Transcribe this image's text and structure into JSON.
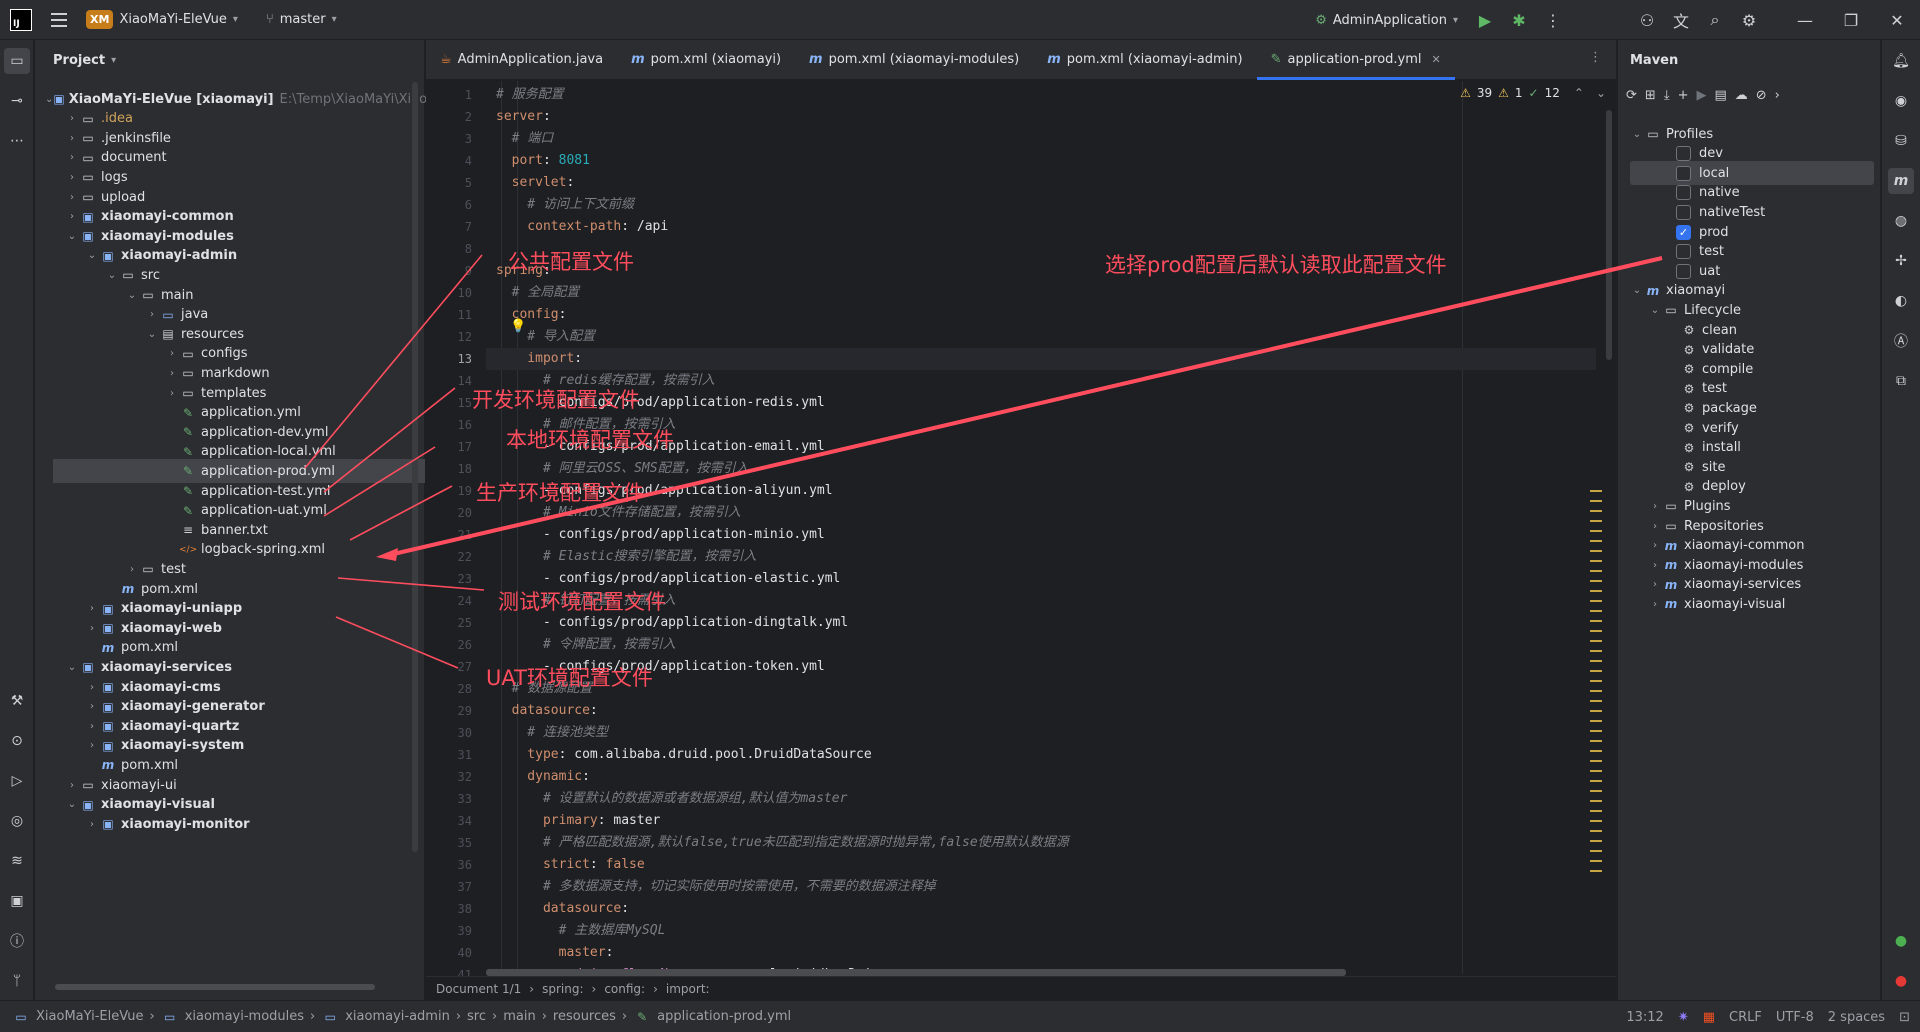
{
  "titlebar": {
    "project_badge": "XM",
    "project_name": "XiaoMaYi-EleVue",
    "branch": "master",
    "run_config": "AdminApplication"
  },
  "project_panel": {
    "title": "Project",
    "tree": [
      {
        "label": "XiaoMaYi-EleVue [xiaomayi]",
        "extra": "E:\\Temp\\XiaoMaYi\\XiaoMa",
        "depth": 0,
        "expanded": true,
        "icon": "module-folder-icon",
        "bold": true
      },
      {
        "label": ".idea",
        "depth": 1,
        "expanded": false,
        "icon": "folder-icon"
      },
      {
        "label": ".jenkinsfile",
        "depth": 1,
        "expanded": false,
        "icon": "folder-icon"
      },
      {
        "label": "document",
        "depth": 1,
        "expanded": false,
        "icon": "folder-icon"
      },
      {
        "label": "logs",
        "depth": 1,
        "expanded": false,
        "icon": "folder-icon"
      },
      {
        "label": "upload",
        "depth": 1,
        "expanded": false,
        "icon": "folder-icon"
      },
      {
        "label": "xiaomayi-common",
        "depth": 1,
        "expanded": false,
        "icon": "module-folder-icon",
        "bold": true
      },
      {
        "label": "xiaomayi-modules",
        "depth": 1,
        "expanded": true,
        "icon": "module-folder-icon",
        "bold": true
      },
      {
        "label": "xiaomayi-admin",
        "depth": 2,
        "expanded": true,
        "icon": "module-folder-icon",
        "bold": true
      },
      {
        "label": "src",
        "depth": 3,
        "expanded": true,
        "icon": "folder-icon"
      },
      {
        "label": "main",
        "depth": 4,
        "expanded": true,
        "icon": "folder-icon"
      },
      {
        "label": "java",
        "depth": 5,
        "expanded": false,
        "icon": "source-folder-icon"
      },
      {
        "label": "resources",
        "depth": 5,
        "expanded": true,
        "icon": "resources-folder-icon"
      },
      {
        "label": "configs",
        "depth": 6,
        "expanded": false,
        "icon": "folder-icon"
      },
      {
        "label": "markdown",
        "depth": 6,
        "expanded": false,
        "icon": "folder-icon"
      },
      {
        "label": "templates",
        "depth": 6,
        "expanded": false,
        "icon": "folder-icon"
      },
      {
        "label": "application.yml",
        "depth": 6,
        "icon": "yaml-file-icon"
      },
      {
        "label": "application-dev.yml",
        "depth": 6,
        "icon": "yaml-file-icon"
      },
      {
        "label": "application-local.yml",
        "depth": 6,
        "icon": "yaml-file-icon"
      },
      {
        "label": "application-prod.yml",
        "depth": 6,
        "icon": "yaml-file-icon",
        "selected": true
      },
      {
        "label": "application-test.yml",
        "depth": 6,
        "icon": "yaml-file-icon"
      },
      {
        "label": "application-uat.yml",
        "depth": 6,
        "icon": "yaml-file-icon"
      },
      {
        "label": "banner.txt",
        "depth": 6,
        "icon": "text-file-icon"
      },
      {
        "label": "logback-spring.xml",
        "depth": 6,
        "icon": "xml-file-icon"
      },
      {
        "label": "test",
        "depth": 4,
        "expanded": false,
        "icon": "folder-icon"
      },
      {
        "label": "pom.xml",
        "depth": 3,
        "icon": "maven-file-icon"
      },
      {
        "label": "xiaomayi-uniapp",
        "depth": 2,
        "expanded": false,
        "icon": "module-folder-icon",
        "bold": true
      },
      {
        "label": "xiaomayi-web",
        "depth": 2,
        "expanded": false,
        "icon": "module-folder-icon",
        "bold": true
      },
      {
        "label": "pom.xml",
        "depth": 2,
        "icon": "maven-file-icon"
      },
      {
        "label": "xiaomayi-services",
        "depth": 1,
        "expanded": true,
        "icon": "module-folder-icon",
        "bold": true
      },
      {
        "label": "xiaomayi-cms",
        "depth": 2,
        "expanded": false,
        "icon": "module-folder-icon",
        "bold": true
      },
      {
        "label": "xiaomayi-generator",
        "depth": 2,
        "expanded": false,
        "icon": "module-folder-icon",
        "bold": true
      },
      {
        "label": "xiaomayi-quartz",
        "depth": 2,
        "expanded": false,
        "icon": "module-folder-icon",
        "bold": true
      },
      {
        "label": "xiaomayi-system",
        "depth": 2,
        "expanded": false,
        "icon": "module-folder-icon",
        "bold": true
      },
      {
        "label": "pom.xml",
        "depth": 2,
        "icon": "maven-file-icon"
      },
      {
        "label": "xiaomayi-ui",
        "depth": 1,
        "expanded": false,
        "icon": "folder-icon"
      },
      {
        "label": "xiaomayi-visual",
        "depth": 1,
        "expanded": true,
        "icon": "module-folder-icon",
        "bold": true
      },
      {
        "label": "xiaomayi-monitor",
        "depth": 2,
        "expanded": false,
        "icon": "module-folder-icon",
        "bold": true
      }
    ]
  },
  "editor": {
    "tabs": [
      {
        "label": "AdminApplication.java",
        "icon": "java-class-icon"
      },
      {
        "label": "pom.xml (xiaomayi)",
        "icon": "maven-file-icon"
      },
      {
        "label": "pom.xml (xiaomayi-modules)",
        "icon": "maven-file-icon"
      },
      {
        "label": "pom.xml (xiaomayi-admin)",
        "icon": "maven-file-icon"
      },
      {
        "label": "application-prod.yml",
        "icon": "yaml-file-icon",
        "active": true,
        "closable": true
      }
    ],
    "inspections": {
      "warnings": "39",
      "weak_warnings": "1",
      "ok": "12"
    },
    "current_line": 13,
    "lines": [
      {
        "n": 1,
        "parts": [
          {
            "t": "# 服务配置",
            "c": "c"
          }
        ]
      },
      {
        "n": 2,
        "parts": [
          {
            "t": "server",
            "c": "k"
          },
          {
            "t": ":",
            "c": "v"
          }
        ]
      },
      {
        "n": 3,
        "parts": [
          {
            "t": "  # 端口",
            "c": "c"
          }
        ]
      },
      {
        "n": 4,
        "parts": [
          {
            "t": "  port",
            "c": "k"
          },
          {
            "t": ": ",
            "c": "v"
          },
          {
            "t": "8081",
            "c": "n"
          }
        ]
      },
      {
        "n": 5,
        "parts": [
          {
            "t": "  servlet",
            "c": "k"
          },
          {
            "t": ":",
            "c": "v"
          }
        ]
      },
      {
        "n": 6,
        "parts": [
          {
            "t": "    # 访问上下文前缀",
            "c": "c"
          }
        ]
      },
      {
        "n": 7,
        "parts": [
          {
            "t": "    context-path",
            "c": "k"
          },
          {
            "t": ": /api",
            "c": "v"
          }
        ]
      },
      {
        "n": 8,
        "parts": []
      },
      {
        "n": 9,
        "parts": [
          {
            "t": "spring",
            "c": "k"
          },
          {
            "t": ":",
            "c": "v"
          }
        ]
      },
      {
        "n": 10,
        "parts": [
          {
            "t": "  # 全局配置",
            "c": "c"
          }
        ]
      },
      {
        "n": 11,
        "parts": [
          {
            "t": "  config",
            "c": "k"
          },
          {
            "t": ":",
            "c": "v"
          }
        ]
      },
      {
        "n": 12,
        "parts": [
          {
            "t": "    # 导入配置",
            "c": "c"
          }
        ]
      },
      {
        "n": 13,
        "parts": [
          {
            "t": "    import",
            "c": "k"
          },
          {
            "t": ":",
            "c": "v"
          }
        ]
      },
      {
        "n": 14,
        "parts": [
          {
            "t": "      # redis缓存配置，按需引入",
            "c": "c"
          }
        ]
      },
      {
        "n": 15,
        "parts": [
          {
            "t": "      - configs/prod/application-redis.yml",
            "c": "v"
          }
        ]
      },
      {
        "n": 16,
        "parts": [
          {
            "t": "      # 邮件配置，按需引入",
            "c": "c"
          }
        ]
      },
      {
        "n": 17,
        "parts": [
          {
            "t": "      - configs/prod/application-email.yml",
            "c": "v"
          }
        ]
      },
      {
        "n": 18,
        "parts": [
          {
            "t": "      # 阿里云OSS、SMS配置，按需引入",
            "c": "c"
          }
        ]
      },
      {
        "n": 19,
        "parts": [
          {
            "t": "      - configs/prod/application-aliyun.yml",
            "c": "v"
          }
        ]
      },
      {
        "n": 20,
        "parts": [
          {
            "t": "      # Minio文件存储配置，按需引入",
            "c": "c"
          }
        ]
      },
      {
        "n": 21,
        "parts": [
          {
            "t": "      - configs/prod/application-minio.yml",
            "c": "v"
          }
        ]
      },
      {
        "n": 22,
        "parts": [
          {
            "t": "      # Elastic搜索引擎配置，按需引入",
            "c": "c"
          }
        ]
      },
      {
        "n": 23,
        "parts": [
          {
            "t": "      - configs/prod/application-elastic.yml",
            "c": "v"
          }
        ]
      },
      {
        "n": 24,
        "parts": [
          {
            "t": "      # 钉钉配置，按需引入",
            "c": "c"
          }
        ]
      },
      {
        "n": 25,
        "parts": [
          {
            "t": "      - configs/prod/application-dingtalk.yml",
            "c": "v"
          }
        ]
      },
      {
        "n": 26,
        "parts": [
          {
            "t": "      # 令牌配置，按需引入",
            "c": "c"
          }
        ]
      },
      {
        "n": 27,
        "parts": [
          {
            "t": "      - configs/prod/application-token.yml",
            "c": "v"
          }
        ]
      },
      {
        "n": 28,
        "parts": [
          {
            "t": "  # 数据源配置",
            "c": "c"
          }
        ]
      },
      {
        "n": 29,
        "parts": [
          {
            "t": "  datasource",
            "c": "k"
          },
          {
            "t": ":",
            "c": "v"
          }
        ]
      },
      {
        "n": 30,
        "parts": [
          {
            "t": "    # 连接池类型",
            "c": "c"
          }
        ]
      },
      {
        "n": 31,
        "parts": [
          {
            "t": "    type",
            "c": "k"
          },
          {
            "t": ": com.alibaba.druid.pool.DruidDataSource",
            "c": "v"
          }
        ]
      },
      {
        "n": 32,
        "parts": [
          {
            "t": "    dynamic",
            "c": "k"
          },
          {
            "t": ":",
            "c": "v"
          }
        ]
      },
      {
        "n": 33,
        "parts": [
          {
            "t": "      # 设置默认的数据源或者数据源组,默认值为master",
            "c": "c"
          }
        ]
      },
      {
        "n": 34,
        "parts": [
          {
            "t": "      primary",
            "c": "k"
          },
          {
            "t": ": master",
            "c": "v"
          }
        ]
      },
      {
        "n": 35,
        "parts": [
          {
            "t": "      # 严格匹配数据源,默认false,true未匹配到指定数据源时抛异常,false使用默认数据源",
            "c": "c"
          }
        ]
      },
      {
        "n": 36,
        "parts": [
          {
            "t": "      strict",
            "c": "k"
          },
          {
            "t": ": ",
            "c": "v"
          },
          {
            "t": "false",
            "c": "k"
          }
        ]
      },
      {
        "n": 37,
        "parts": [
          {
            "t": "      # 多数据源支持，切记实际使用时按需使用，不需要的数据源注释掉",
            "c": "c"
          }
        ]
      },
      {
        "n": 38,
        "parts": [
          {
            "t": "      datasource",
            "c": "k"
          },
          {
            "t": ":",
            "c": "v"
          }
        ]
      },
      {
        "n": 39,
        "parts": [
          {
            "t": "        # 主数据库MySQL",
            "c": "c"
          }
        ]
      },
      {
        "n": 40,
        "parts": [
          {
            "t": "        master",
            "c": "k"
          },
          {
            "t": ":",
            "c": "v"
          }
        ]
      },
      {
        "n": 41,
        "parts": [
          {
            "t": "          driverClassName",
            "c": "kv"
          },
          {
            "t": ": com.mysql.cj.jdbc.Driver",
            "c": "v"
          }
        ]
      }
    ],
    "breadcrumb": [
      "Document 1/1",
      "spring:",
      "config:",
      "import:"
    ]
  },
  "maven": {
    "title": "Maven",
    "tree": [
      {
        "label": "Profiles",
        "depth": 0,
        "expanded": true,
        "icon": "profiles-folder-icon"
      },
      {
        "label": "dev",
        "depth": 1,
        "checkbox": true,
        "checked": false
      },
      {
        "label": "local",
        "depth": 1,
        "checkbox": true,
        "checked": false,
        "selected": true
      },
      {
        "label": "native",
        "depth": 1,
        "checkbox": true,
        "checked": false
      },
      {
        "label": "nativeTest",
        "depth": 1,
        "checkbox": true,
        "checked": false
      },
      {
        "label": "prod",
        "depth": 1,
        "checkbox": true,
        "checked": true
      },
      {
        "label": "test",
        "depth": 1,
        "checkbox": true,
        "checked": false
      },
      {
        "label": "uat",
        "depth": 1,
        "checkbox": true,
        "checked": false
      },
      {
        "label": "xiaomayi",
        "depth": 0,
        "expanded": true,
        "icon": "maven-module-icon"
      },
      {
        "label": "Lifecycle",
        "depth": 1,
        "expanded": true,
        "icon": "lifecycle-folder-icon"
      },
      {
        "label": "clean",
        "depth": 2,
        "icon": "gear-icon"
      },
      {
        "label": "validate",
        "depth": 2,
        "icon": "gear-icon"
      },
      {
        "label": "compile",
        "depth": 2,
        "icon": "gear-icon"
      },
      {
        "label": "test",
        "depth": 2,
        "icon": "gear-icon"
      },
      {
        "label": "package",
        "depth": 2,
        "icon": "gear-icon"
      },
      {
        "label": "verify",
        "depth": 2,
        "icon": "gear-icon"
      },
      {
        "label": "install",
        "depth": 2,
        "icon": "gear-icon"
      },
      {
        "label": "site",
        "depth": 2,
        "icon": "gear-icon"
      },
      {
        "label": "deploy",
        "depth": 2,
        "icon": "gear-icon"
      },
      {
        "label": "Plugins",
        "depth": 1,
        "expanded": false,
        "icon": "plugins-folder-icon"
      },
      {
        "label": "Repositories",
        "depth": 1,
        "expanded": false,
        "icon": "repositories-folder-icon"
      },
      {
        "label": "xiaomayi-common",
        "depth": 1,
        "expanded": false,
        "icon": "maven-module-icon"
      },
      {
        "label": "xiaomayi-modules",
        "depth": 1,
        "expanded": false,
        "icon": "maven-module-icon"
      },
      {
        "label": "xiaomayi-services",
        "depth": 1,
        "expanded": false,
        "icon": "maven-module-icon"
      },
      {
        "label": "xiaomayi-visual",
        "depth": 1,
        "expanded": false,
        "icon": "maven-module-icon"
      }
    ]
  },
  "annotations": {
    "public_config": "公共配置文件",
    "dev_config": "开发环境配置文件",
    "local_config": "本地环境配置文件",
    "prod_config": "生产环境配置文件",
    "test_config": "测试环境配置文件",
    "uat_config": "UAT环境配置文件",
    "prod_profile_note": "选择prod配置后默认读取此配置文件"
  },
  "statusbar": {
    "crumbs": [
      "XiaoMaYi-EleVue",
      "xiaomayi-modules",
      "xiaomayi-admin",
      "src",
      "main",
      "resources",
      "application-prod.yml"
    ],
    "position": "13:12",
    "line_sep": "CRLF",
    "encoding": "UTF-8",
    "indent": "2 spaces"
  },
  "colors": {
    "accent": "#3574f0",
    "annotation": "#ff4d5e",
    "background": "#1e1f22",
    "panel": "#2b2d30"
  }
}
